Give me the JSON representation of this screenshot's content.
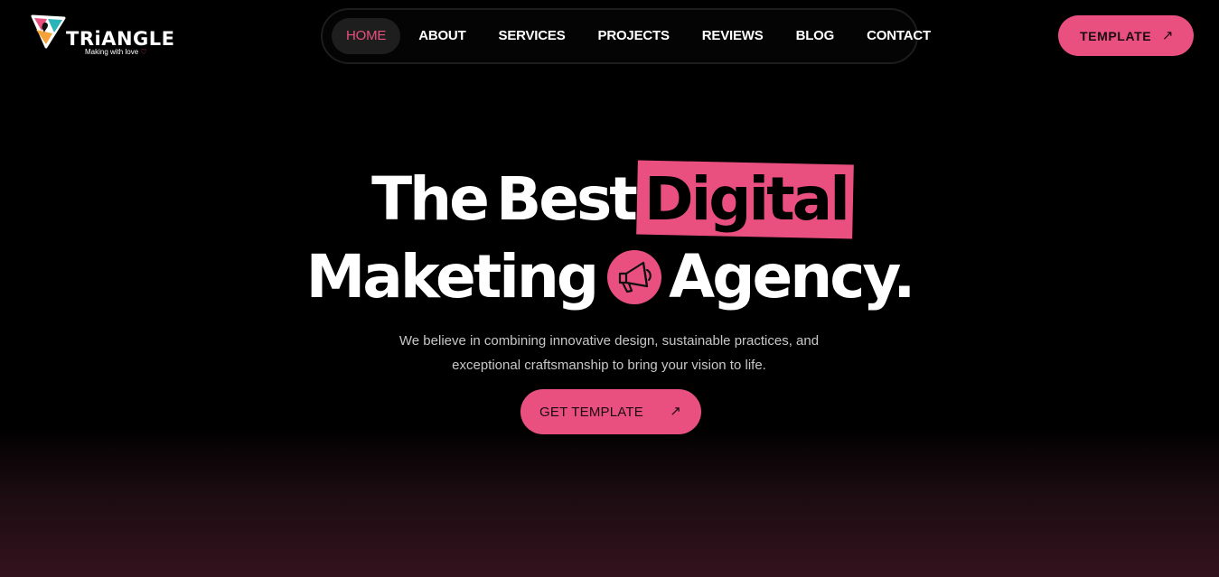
{
  "brand": {
    "name": "TRiANGLE",
    "tagline": "Making with love",
    "tagline_icon": "heart-icon"
  },
  "nav": {
    "items": [
      {
        "label": "HOME",
        "active": true
      },
      {
        "label": "ABOUT"
      },
      {
        "label": "SERVICES"
      },
      {
        "label": "PROJECTS"
      },
      {
        "label": "REVIEWS"
      },
      {
        "label": "BLOG"
      },
      {
        "label": "CONTACT"
      }
    ]
  },
  "header": {
    "cta_label": "TEMPLATE",
    "cta_icon": "arrow-up-right-icon"
  },
  "hero": {
    "line1_word1": "The",
    "line1_word2": "Best",
    "line1_highlight": "Digital",
    "line2_word1": "Maketing",
    "line2_icon": "megaphone-icon",
    "line2_word2": "Agency.",
    "subtitle": "We believe in combining innovative design, sustainable practices, and exceptional craftsmanship to bring your vision to life.",
    "cta_label": "GET TEMPLATE",
    "cta_icon": "arrow-up-right-icon"
  },
  "colors": {
    "accent": "#e9507f",
    "background": "#000000",
    "nav_border": "#1d1d1d",
    "active_pill": "#1e1e1e"
  }
}
